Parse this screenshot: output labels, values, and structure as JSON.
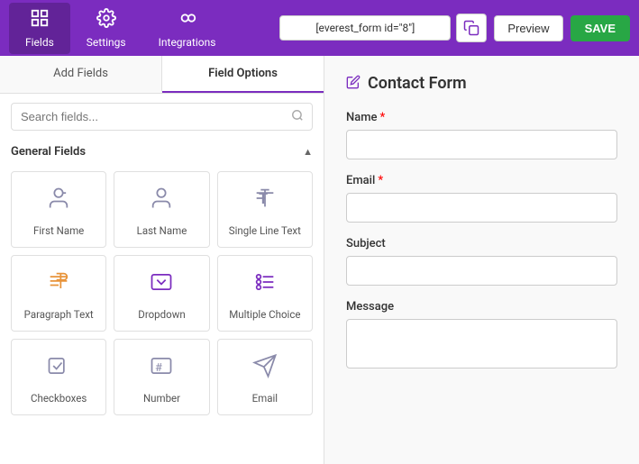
{
  "nav": {
    "items": [
      {
        "id": "fields",
        "label": "Fields",
        "active": true
      },
      {
        "id": "settings",
        "label": "Settings",
        "active": false
      },
      {
        "id": "integrations",
        "label": "Integrations",
        "active": false
      }
    ],
    "shortcode": "[everest_form id=\"8\"]",
    "preview_label": "Preview",
    "save_label": "SAVE"
  },
  "left_panel": {
    "tabs": [
      {
        "id": "add-fields",
        "label": "Add Fields",
        "active": false
      },
      {
        "id": "field-options",
        "label": "Field Options",
        "active": true
      }
    ],
    "search_placeholder": "Search fields...",
    "section_label": "General Fields",
    "fields": [
      {
        "id": "first-name",
        "label": "First Name",
        "icon": "person"
      },
      {
        "id": "last-name",
        "label": "Last Name",
        "icon": "person-outline"
      },
      {
        "id": "single-line",
        "label": "Single Line Text",
        "icon": "text-t"
      },
      {
        "id": "paragraph",
        "label": "Paragraph Text",
        "icon": "paragraph",
        "color": "orange"
      },
      {
        "id": "dropdown",
        "label": "Dropdown",
        "icon": "dropdown",
        "color": "purple"
      },
      {
        "id": "multiple-choice",
        "label": "Multiple Choice",
        "icon": "radio",
        "color": "purple"
      },
      {
        "id": "checkboxes",
        "label": "Checkboxes",
        "icon": "checkbox"
      },
      {
        "id": "number",
        "label": "Number",
        "icon": "hash"
      },
      {
        "id": "email",
        "label": "Email",
        "icon": "email"
      }
    ]
  },
  "right_panel": {
    "form_title": "Contact Form",
    "fields": [
      {
        "id": "name",
        "label": "Name",
        "required": true,
        "type": "input"
      },
      {
        "id": "email",
        "label": "Email",
        "required": true,
        "type": "input"
      },
      {
        "id": "subject",
        "label": "Subject",
        "required": false,
        "type": "input"
      },
      {
        "id": "message",
        "label": "Message",
        "required": false,
        "type": "textarea"
      }
    ]
  }
}
